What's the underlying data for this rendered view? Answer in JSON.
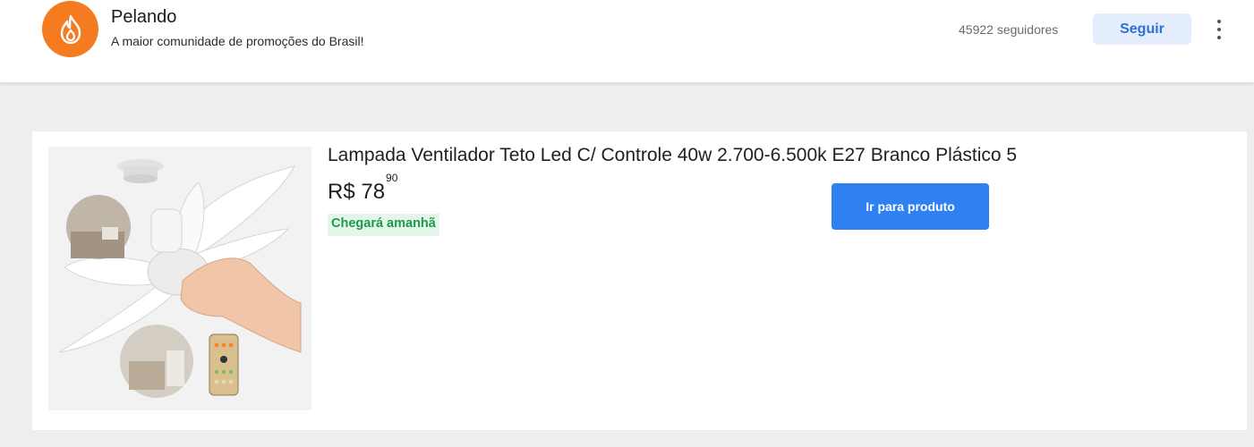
{
  "header": {
    "brand_name": "Pelando",
    "tagline": "A maior comunidade de promoções do Brasil!",
    "followers": "45922 seguidores",
    "follow_label": "Seguir"
  },
  "product": {
    "title": "Lampada Ventilador Teto Led C/ Controle 40w 2.700-6.500k E27 Branco Plástico 5",
    "price_main": "R$ 78",
    "price_cents": "90",
    "shipping": "Chegará amanhã",
    "cta_label": "Ir para produto"
  },
  "colors": {
    "brand_orange": "#f47b20",
    "cta_blue": "#2f80f0",
    "follow_bg": "#e3edfb",
    "shipping_green": "#1e9a4a"
  },
  "icons": {
    "logo": "flame-logo-icon",
    "more": "more-vertical-icon"
  }
}
